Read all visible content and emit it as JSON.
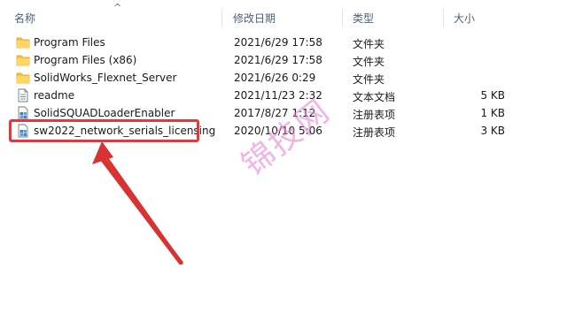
{
  "columns": {
    "name": "名称",
    "modified": "修改日期",
    "type": "类型",
    "size": "大小"
  },
  "files": [
    {
      "name": "Program Files",
      "modified": "2021/6/29 17:58",
      "type": "文件夹",
      "size": "",
      "icon": "folder-icon"
    },
    {
      "name": "Program Files (x86)",
      "modified": "2021/6/29 17:58",
      "type": "文件夹",
      "size": "",
      "icon": "folder-icon"
    },
    {
      "name": "SolidWorks_Flexnet_Server",
      "modified": "2021/6/26 0:29",
      "type": "文件夹",
      "size": "",
      "icon": "folder-icon"
    },
    {
      "name": "readme",
      "modified": "2021/11/23 2:32",
      "type": "文本文档",
      "size": "5 KB",
      "icon": "text-document-icon"
    },
    {
      "name": "SolidSQUADLoaderEnabler",
      "modified": "2017/8/27 1:12",
      "type": "注册表项",
      "size": "1 KB",
      "icon": "registry-file-icon"
    },
    {
      "name": "sw2022_network_serials_licensing",
      "modified": "2020/10/10 5:06",
      "type": "注册表项",
      "size": "3 KB",
      "icon": "registry-file-icon"
    }
  ],
  "watermark": "锦技网",
  "colors": {
    "highlight": "#e23a3a",
    "arrow": "#d93232",
    "folder": "#f5c342",
    "watermark": "#e57ad0"
  }
}
